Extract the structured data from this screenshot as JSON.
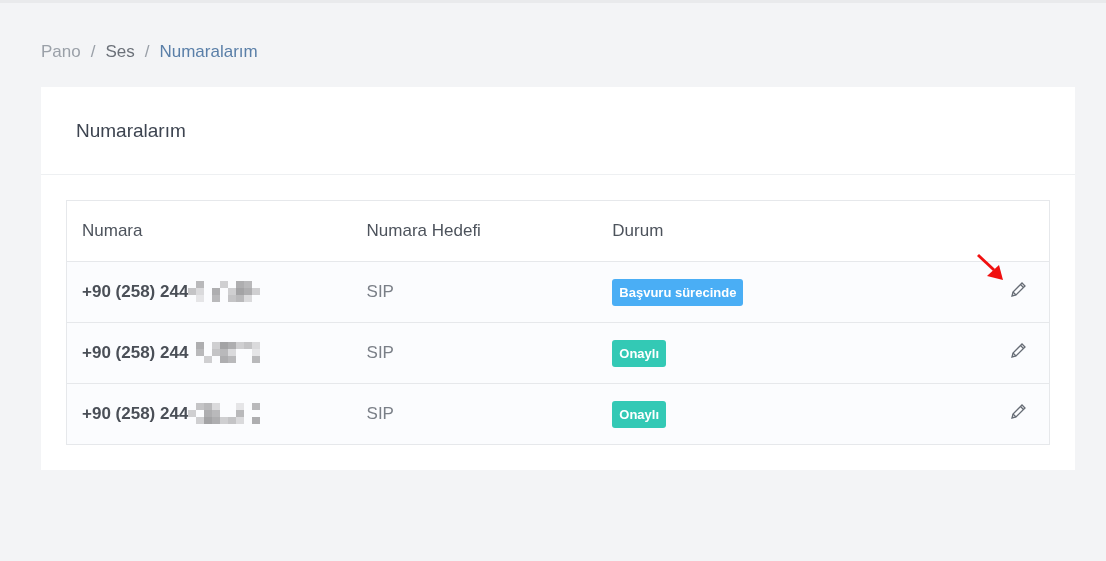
{
  "breadcrumb": [
    {
      "label": "Pano",
      "current": false
    },
    {
      "label": "Ses",
      "current": false
    },
    {
      "label": "Numaralarım",
      "current": true
    }
  ],
  "breadcrumb_separator": "/",
  "card": {
    "title": "Numaralarım"
  },
  "table": {
    "columns": [
      "Numara",
      "Numara Hedefi",
      "Durum"
    ],
    "rows": [
      {
        "number": "+90 (258) 244",
        "target": "SIP",
        "status": "Başvuru sürecinde",
        "color": "#4aaef5",
        "highlighted": true
      },
      {
        "number": "+90 (258) 244",
        "target": "SIP",
        "status": "Onaylı",
        "color": "#33c9b5",
        "highlighted": false
      },
      {
        "number": "+90 (258) 244",
        "target": "SIP",
        "status": "Onaylı",
        "color": "#33c9b5",
        "highlighted": false
      }
    ]
  }
}
